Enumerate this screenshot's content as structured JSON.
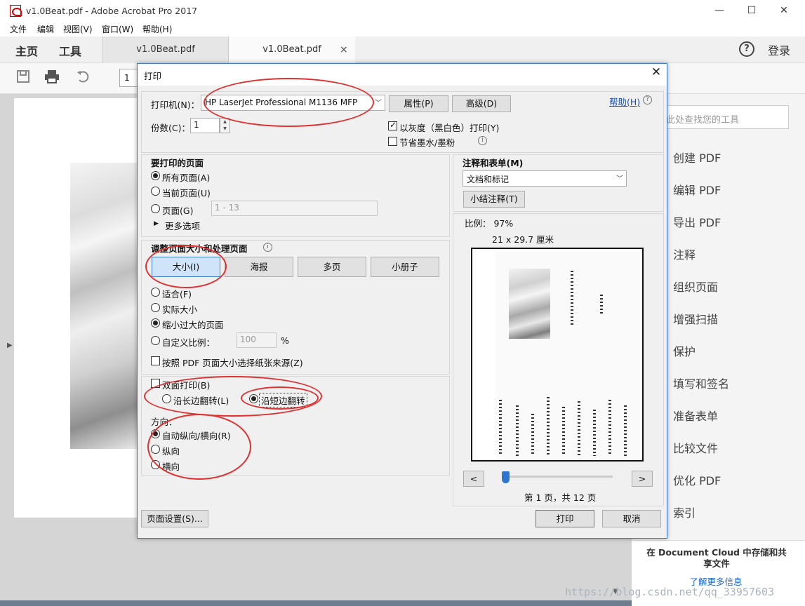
{
  "app": {
    "title": "v1.0Beat.pdf - Adobe Acrobat Pro 2017",
    "window_controls": [
      "—",
      "☐",
      "✕"
    ]
  },
  "menubar": [
    "文件",
    "编辑",
    "视图(V)",
    "窗口(W)",
    "帮助(H)"
  ],
  "navbar": {
    "home": "主页",
    "tools": "工具",
    "doc_tabs": [
      "v1.0Beat.pdf",
      "v1.0Beat.pdf"
    ],
    "tab_close": "×",
    "help": "?",
    "login": "登录"
  },
  "toolbar": {
    "page_number": "1"
  },
  "right_pane": {
    "search_placeholder": "此处查找您的工具",
    "tools": [
      "创建 PDF",
      "编辑 PDF",
      "导出 PDF",
      "注释",
      "组织页面",
      "增强扫描",
      "保护",
      "填写和签名",
      "准备表单",
      "比较文件",
      "优化 PDF",
      "索引"
    ],
    "cloud_text": "在 Document Cloud 中存储和共享文件",
    "cloud_link": "了解更多信息"
  },
  "watermark": "https://blog.csdn.net/qq_33957603",
  "dialog": {
    "title": "打印",
    "close": "✕",
    "printer_label": "打印机(N)：",
    "printer_value": "HP LaserJet Professional M1136 MFP",
    "properties_btn": "属性(P)",
    "advanced_btn": "高级(D)",
    "help_link": "帮助(H)",
    "copies_label": "份数(C)：",
    "copies_value": "1",
    "grayscale_label": "以灰度（黑白色）打印(Y)",
    "grayscale_checked": true,
    "save_ink_label": "节省墨水/墨粉",
    "save_ink_checked": false,
    "pages_section": {
      "heading": "要打印的页面",
      "all_pages": "所有页面(A)",
      "current_page": "当前页面(U)",
      "pages": "页面(G)",
      "pages_range": "1 - 13",
      "more_options": "更多选项",
      "selected": "all_pages"
    },
    "sizing_section": {
      "heading": "调整页面大小和处理页面",
      "buttons": [
        "大小(I)",
        "海报",
        "多页",
        "小册子"
      ],
      "selected_button": "大小(I)",
      "fit": "适合(F)",
      "actual_size": "实际大小",
      "shrink_oversized": "缩小过大的页面",
      "custom_scale": "自定义比例：",
      "custom_scale_value": "100",
      "percent": "%",
      "choose_paper_source": "按照 PDF 页面大小选择纸张来源(Z)",
      "selected": "shrink_oversized"
    },
    "duplex_section": {
      "duplex_label": "双面打印(B)",
      "duplex_checked": false,
      "long_edge": "沿长边翻转(L)",
      "short_edge": "沿短边翻转",
      "selected": "short_edge"
    },
    "orientation_section": {
      "heading": "方向：",
      "auto": "自动纵向/横向(R)",
      "portrait": "纵向",
      "landscape": "横向",
      "selected": "auto"
    },
    "comments_section": {
      "heading": "注释和表单(M)",
      "value": "文档和标记",
      "summarize_btn": "小结注释(T)"
    },
    "preview": {
      "scale_label": "比例： 97%",
      "paper_size": "21 x 29.7 厘米",
      "prev": "<",
      "next": ">",
      "page_info": "第 1 页，共 12 页"
    },
    "page_setup_btn": "页面设置(S)...",
    "print_btn": "打印",
    "cancel_btn": "取消"
  }
}
